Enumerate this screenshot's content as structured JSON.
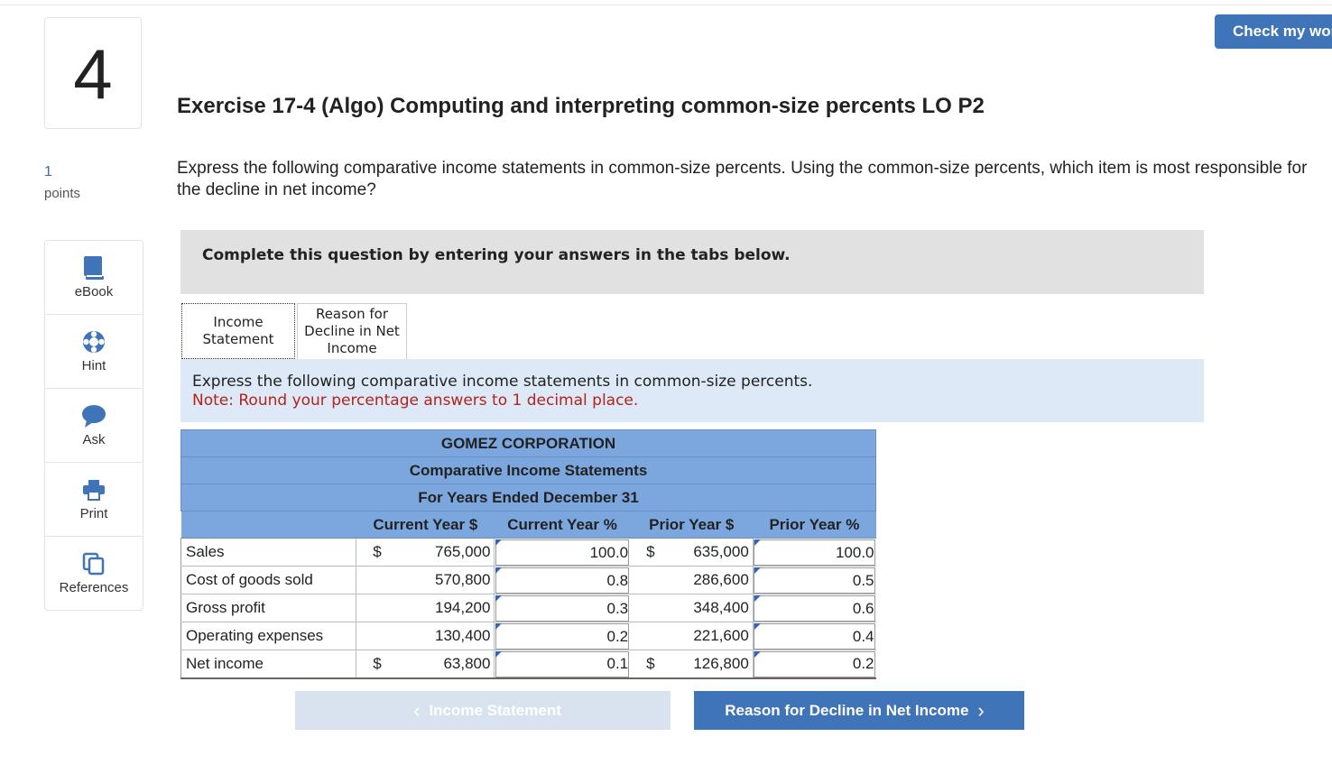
{
  "header": {
    "check_button": "Check my work"
  },
  "question": {
    "number": "4",
    "points_value": "1",
    "points_label": "points"
  },
  "sidebar": {
    "items": [
      {
        "label": "eBook",
        "icon": "book-icon"
      },
      {
        "label": "Hint",
        "icon": "lifebuoy-icon"
      },
      {
        "label": "Ask",
        "icon": "chat-bubble-icon"
      },
      {
        "label": "Print",
        "icon": "printer-icon"
      },
      {
        "label": "References",
        "icon": "copy-icon"
      }
    ]
  },
  "exercise": {
    "title": "Exercise 17-4 (Algo) Computing and interpreting common-size percents LO P2",
    "prompt": "Express the following comparative income statements in common-size percents. Using the common-size percents, which item is most responsible for the decline in net income?"
  },
  "instructions": "Complete this question by entering your answers in the tabs below.",
  "tabs": [
    {
      "label": "Income\nStatement"
    },
    {
      "label": "Reason for\nDecline in Net\nIncome"
    }
  ],
  "panel": {
    "line1": "Express the following comparative income statements in common-size percents.",
    "note": "Note: Round your percentage answers to 1 decimal place."
  },
  "statement": {
    "company": "GOMEZ CORPORATION",
    "name": "Comparative Income Statements",
    "period": "For Years Ended December 31",
    "columns": [
      "Current Year $",
      "Current Year %",
      "Prior Year $",
      "Prior Year %"
    ],
    "rows": [
      {
        "label": "Sales",
        "cur_sign": "$",
        "cur": "765,000",
        "cur_pct": "100.0",
        "pri_sign": "$",
        "pri": "635,000",
        "pri_pct": "100.0"
      },
      {
        "label": "Cost of goods sold",
        "cur_sign": "",
        "cur": "570,800",
        "cur_pct": "0.8",
        "pri_sign": "",
        "pri": "286,600",
        "pri_pct": "0.5"
      },
      {
        "label": "Gross profit",
        "cur_sign": "",
        "cur": "194,200",
        "cur_pct": "0.3",
        "pri_sign": "",
        "pri": "348,400",
        "pri_pct": "0.6"
      },
      {
        "label": "Operating expenses",
        "cur_sign": "",
        "cur": "130,400",
        "cur_pct": "0.2",
        "pri_sign": "",
        "pri": "221,600",
        "pri_pct": "0.4"
      },
      {
        "label": "Net income",
        "cur_sign": "$",
        "cur": "63,800",
        "cur_pct": "0.1",
        "pri_sign": "$",
        "pri": "126,800",
        "pri_pct": "0.2"
      }
    ]
  },
  "nav": {
    "prev": "Income Statement",
    "next": "Reason for Decline in Net Income"
  },
  "colors": {
    "accent": "#3f74b8",
    "table_header": "#7ba7de",
    "panel_bg": "#dde9f6",
    "note": "#b5221b"
  }
}
